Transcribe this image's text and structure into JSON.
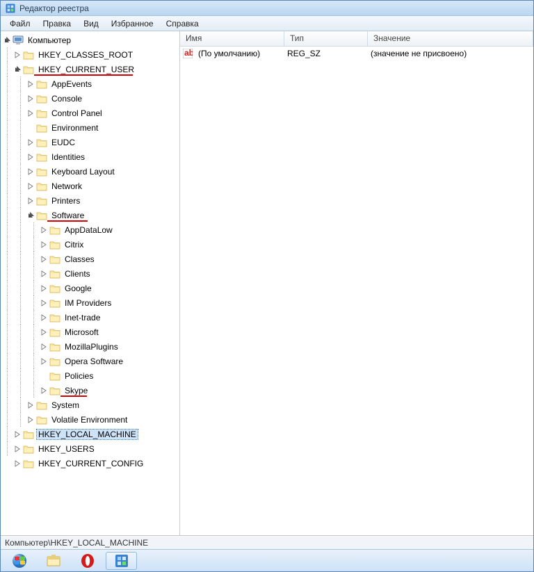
{
  "window": {
    "title": "Редактор реестра"
  },
  "menu": {
    "file": "Файл",
    "edit": "Правка",
    "view": "Вид",
    "favorites": "Избранное",
    "help": "Справка"
  },
  "tree": {
    "root": "Компьютер",
    "hkcr": "HKEY_CLASSES_ROOT",
    "hkcu": "HKEY_CURRENT_USER",
    "hkcu_children": {
      "appevents": "AppEvents",
      "console": "Console",
      "controlpanel": "Control Panel",
      "environment": "Environment",
      "eudc": "EUDC",
      "identities": "Identities",
      "keyboard": "Keyboard Layout",
      "network": "Network",
      "printers": "Printers",
      "software": "Software",
      "system": "System",
      "volatile": "Volatile Environment"
    },
    "software_children": {
      "appdatalow": "AppDataLow",
      "citrix": "Citrix",
      "classes": "Classes",
      "clients": "Clients",
      "google": "Google",
      "improviders": "IM Providers",
      "inettrade": "Inet-trade",
      "microsoft": "Microsoft",
      "mozilla": "MozillaPlugins",
      "opera": "Opera Software",
      "policies": "Policies",
      "skype": "Skype"
    },
    "hklm": "HKEY_LOCAL_MACHINE",
    "hku": "HKEY_USERS",
    "hkcc": "HKEY_CURRENT_CONFIG"
  },
  "list": {
    "col_name": "Имя",
    "col_type": "Тип",
    "col_value": "Значение",
    "row_default_name": "(По умолчанию)",
    "row_default_type": "REG_SZ",
    "row_default_value": "(значение не присвоено)"
  },
  "statusbar": {
    "path": "Компьютер\\HKEY_LOCAL_MACHINE"
  },
  "taskbar": {
    "start": "start-button",
    "explorer": "explorer-icon",
    "opera": "opera-icon",
    "regedit": "regedit-icon"
  },
  "annotations": {
    "underlined_keys": [
      "HKEY_CURRENT_USER",
      "Software",
      "Skype"
    ]
  }
}
